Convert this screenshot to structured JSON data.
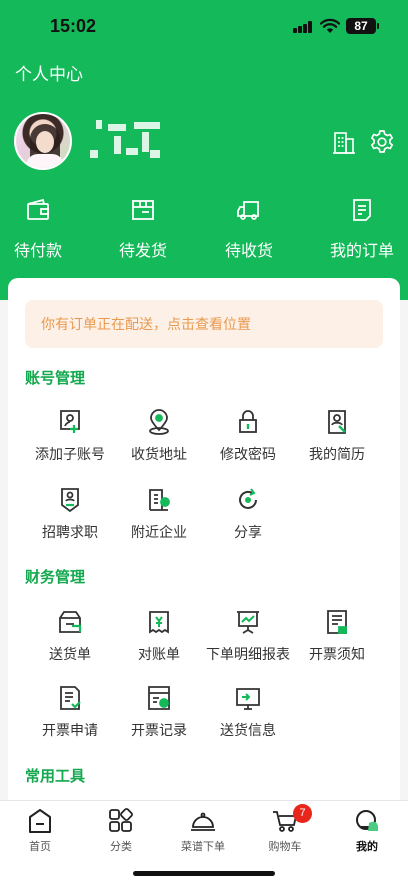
{
  "status_bar": {
    "time": "15:02",
    "battery": "87"
  },
  "header": {
    "title": "个人中心"
  },
  "orders": [
    {
      "label": "待付款",
      "icon": "wallet-icon"
    },
    {
      "label": "待发货",
      "icon": "package-icon"
    },
    {
      "label": "待收货",
      "icon": "truck-icon"
    },
    {
      "label": "我的订单",
      "icon": "order-list-icon"
    }
  ],
  "notice": "你有订单正在配送，点击查看位置",
  "sections": {
    "account": {
      "title": "账号管理",
      "items": [
        {
          "label": "添加子账号",
          "icon": "add-subaccount-icon"
        },
        {
          "label": "收货地址",
          "icon": "location-icon"
        },
        {
          "label": "修改密码",
          "icon": "lock-icon"
        },
        {
          "label": "我的简历",
          "icon": "resume-icon"
        },
        {
          "label": "招聘求职",
          "icon": "recruit-icon"
        },
        {
          "label": "附近企业",
          "icon": "nearby-company-icon"
        },
        {
          "label": "分享",
          "icon": "share-icon"
        }
      ]
    },
    "finance": {
      "title": "财务管理",
      "items": [
        {
          "label": "送货单",
          "icon": "delivery-note-icon"
        },
        {
          "label": "对账单",
          "icon": "statement-icon"
        },
        {
          "label": "下单明细报表",
          "icon": "report-icon"
        },
        {
          "label": "开票须知",
          "icon": "invoice-notice-icon"
        },
        {
          "label": "开票申请",
          "icon": "invoice-apply-icon"
        },
        {
          "label": "开票记录",
          "icon": "invoice-record-icon"
        },
        {
          "label": "送货信息",
          "icon": "delivery-info-icon"
        }
      ]
    },
    "tools": {
      "title": "常用工具"
    }
  },
  "tabbar": [
    {
      "label": "首页",
      "icon": "home-icon"
    },
    {
      "label": "分类",
      "icon": "category-icon"
    },
    {
      "label": "菜谱下单",
      "icon": "cloche-icon"
    },
    {
      "label": "购物车",
      "icon": "cart-icon",
      "badge": "7"
    },
    {
      "label": "我的",
      "icon": "profile-icon"
    }
  ],
  "colors": {
    "primary": "#14b95a",
    "section_title": "#14a84f",
    "notice_bg": "#fdf0e6",
    "notice_text": "#e99a50",
    "badge": "#e8261c"
  }
}
